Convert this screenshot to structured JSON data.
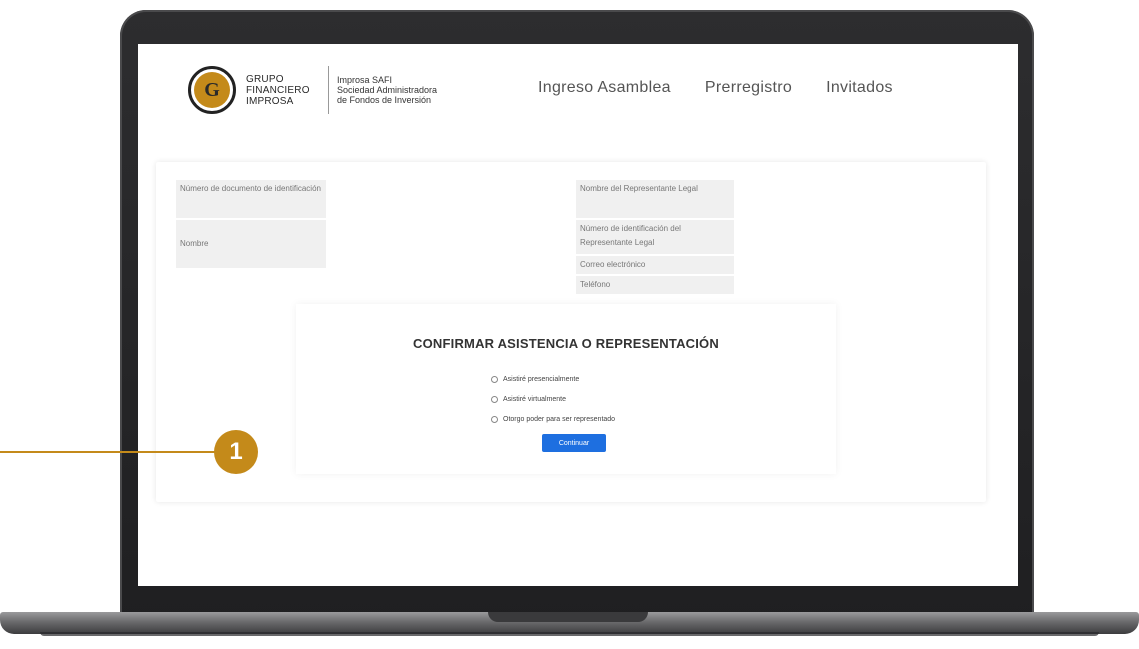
{
  "header": {
    "logo": {
      "line1": "GRUPO",
      "line2": "FINANCIERO",
      "line3": "IMPROSA",
      "sub1": "Improsa SAFI",
      "sub2": "Sociedad Administradora",
      "sub3": "de Fondos de Inversión"
    },
    "nav": {
      "ingreso": "Ingreso Asamblea",
      "prerregistro": "Prerregistro",
      "invitados": "Invitados"
    }
  },
  "form": {
    "left_fields": [
      "Número de documento de identificación",
      "Nombre"
    ],
    "right_fields": [
      "Nombre del Representante Legal",
      "Número de identificación del Representante Legal",
      "Correo electrónico",
      "Teléfono"
    ]
  },
  "confirm": {
    "title": "CONFIRMAR ASISTENCIA O REPRESENTACIÓN",
    "options": [
      "Asistiré presencialmente",
      "Asistiré virtualmente",
      "Otorgo poder para ser representado"
    ],
    "button": "Continuar"
  },
  "annotation": {
    "number": "1",
    "color": "#c48a1a"
  },
  "colors": {
    "button": "#1e6fe0",
    "accent": "#c48a1a"
  }
}
